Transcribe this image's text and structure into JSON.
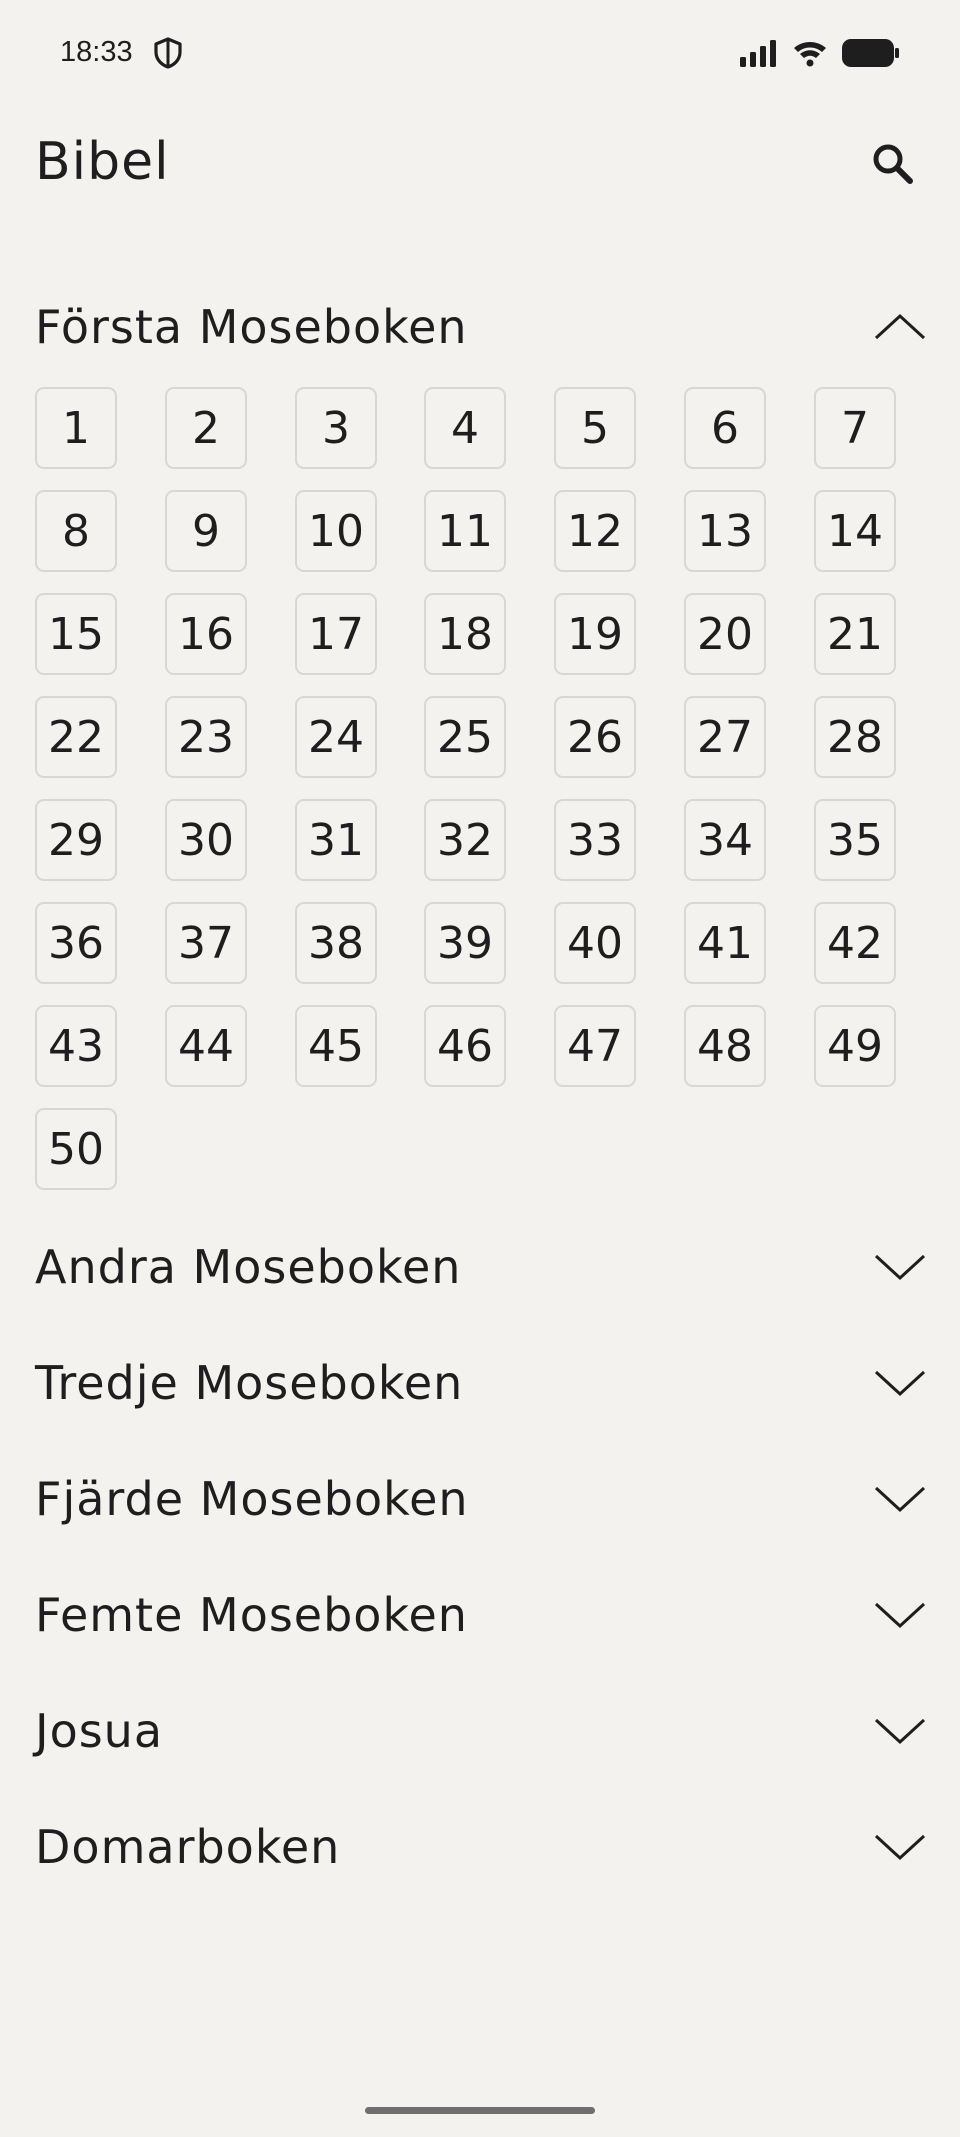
{
  "status_bar": {
    "time": "18:33",
    "icons": [
      "shield-icon",
      "signal-icon",
      "wifi-icon",
      "battery-icon"
    ]
  },
  "header": {
    "title": "Bibel",
    "search_icon": "search-icon"
  },
  "expanded_book": {
    "title": "Första Moseboken",
    "expanded": true,
    "chapters": [
      "1",
      "2",
      "3",
      "4",
      "5",
      "6",
      "7",
      "8",
      "9",
      "10",
      "11",
      "12",
      "13",
      "14",
      "15",
      "16",
      "17",
      "18",
      "19",
      "20",
      "21",
      "22",
      "23",
      "24",
      "25",
      "26",
      "27",
      "28",
      "29",
      "30",
      "31",
      "32",
      "33",
      "34",
      "35",
      "36",
      "37",
      "38",
      "39",
      "40",
      "41",
      "42",
      "43",
      "44",
      "45",
      "46",
      "47",
      "48",
      "49",
      "50"
    ]
  },
  "collapsed_books": [
    {
      "title": "Andra Moseboken"
    },
    {
      "title": "Tredje Moseboken"
    },
    {
      "title": "Fjärde Moseboken"
    },
    {
      "title": "Femte Moseboken"
    },
    {
      "title": "Josua"
    },
    {
      "title": "Domarboken"
    }
  ]
}
